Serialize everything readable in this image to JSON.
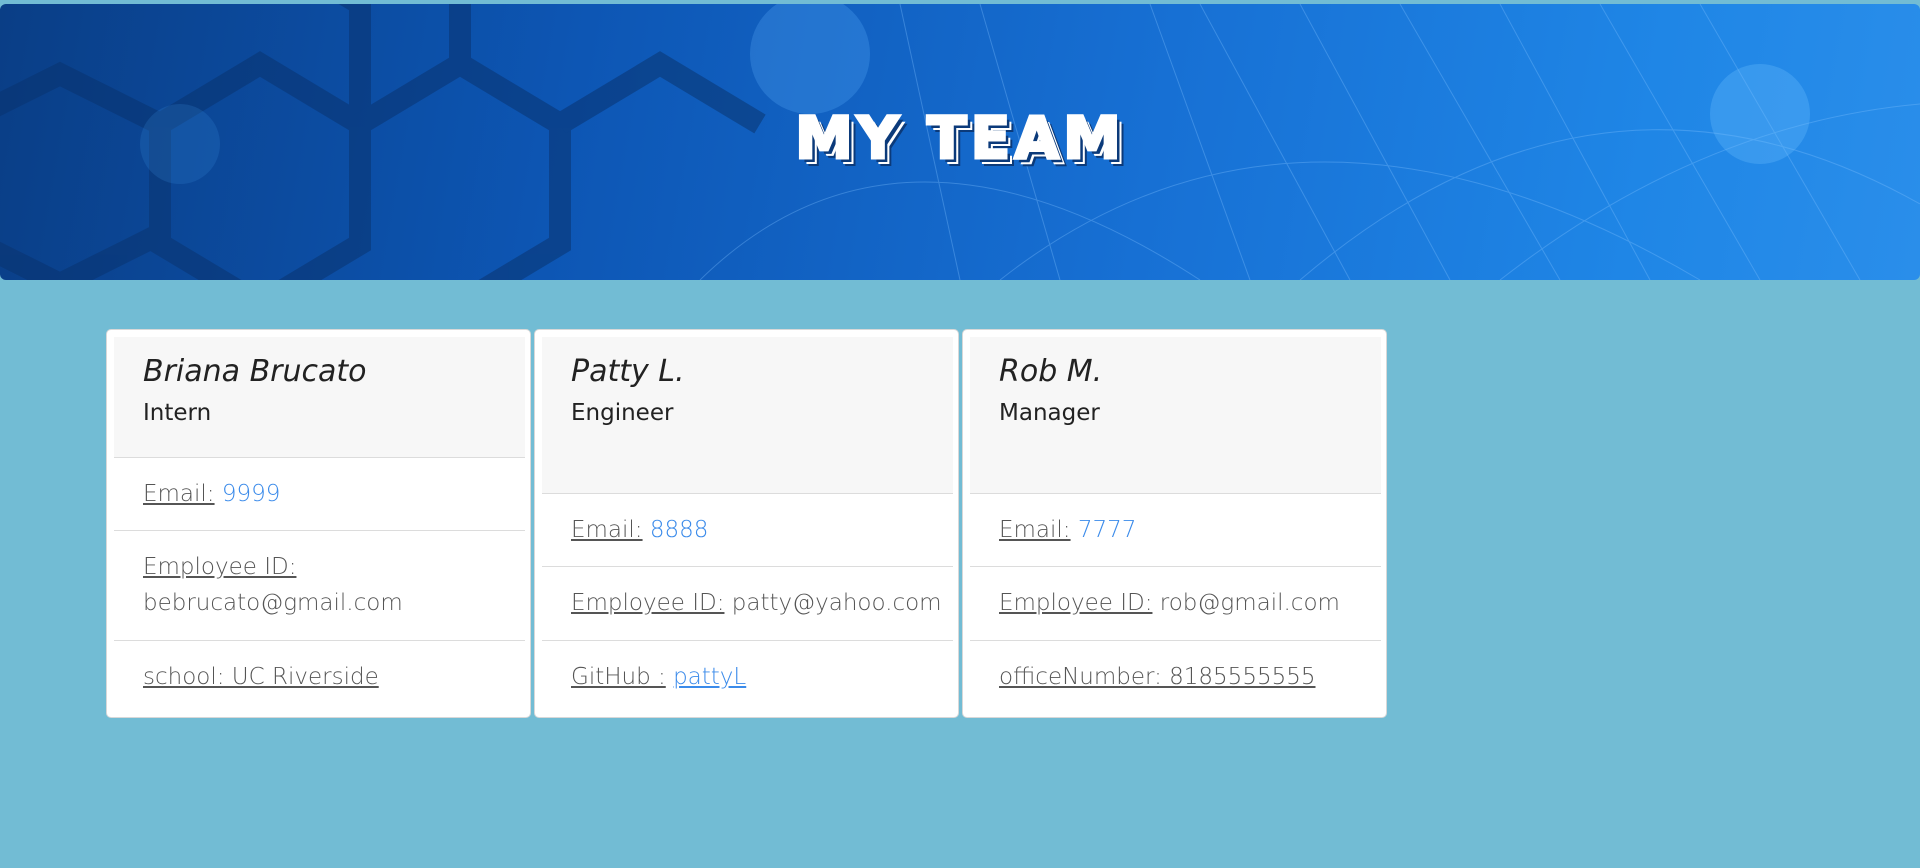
{
  "header": {
    "title": "MY TEAM"
  },
  "team": [
    {
      "name": "Briana Brucato",
      "role": "Intern",
      "email_label": "Email:",
      "email_value": "9999",
      "id_label": "Employee ID:",
      "id_value": "bebrucato@gmail.com",
      "extra_label": "school: UC Riverside",
      "extra_value": ""
    },
    {
      "name": "Patty L.",
      "role": "Engineer",
      "email_label": "Email:",
      "email_value": "8888",
      "id_label": "Employee ID:",
      "id_value": "patty@yahoo.com",
      "extra_label": "GitHub :",
      "extra_value": "pattyL"
    },
    {
      "name": "Rob M.",
      "role": "Manager",
      "email_label": "Email:",
      "email_value": "7777",
      "id_label": "Employee ID:",
      "id_value": "rob@gmail.com",
      "extra_label": "officeNumber: 8185555555",
      "extra_value": ""
    }
  ],
  "colors": {
    "page_background": "#72bcd4",
    "header_blue": "#1770d4",
    "link_blue": "#3b8bea"
  }
}
